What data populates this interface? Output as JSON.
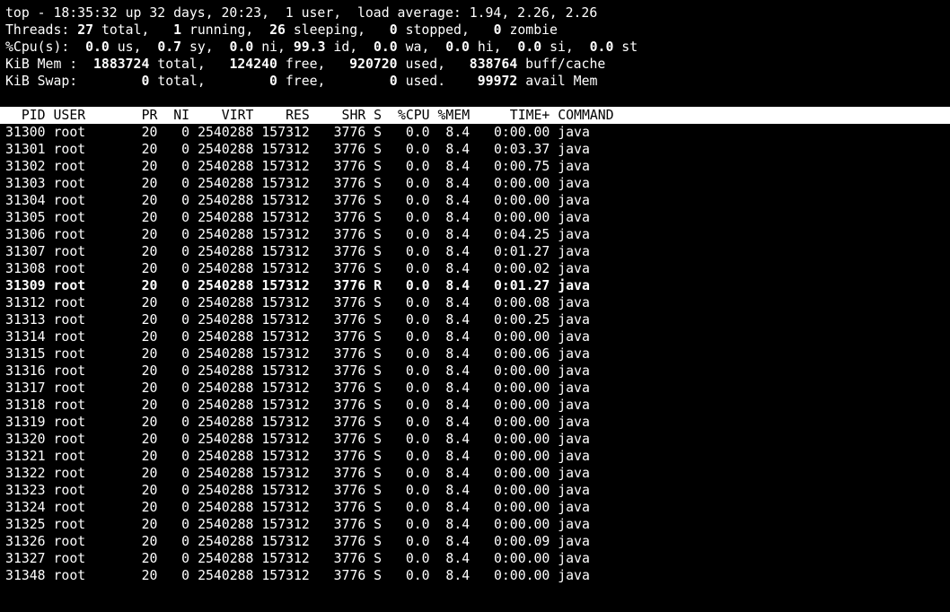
{
  "summary": {
    "line1": {
      "prefix": "top - 18:35:32 up 32 days, 20:23,  1 user,  load average: 1.94, 2.26, 2.26"
    },
    "threads": {
      "label": "Threads:",
      "total": "27",
      "total_label": "total,",
      "running": "1",
      "running_label": "running,",
      "sleeping": "26",
      "sleeping_label": "sleeping,",
      "stopped": "0",
      "stopped_label": "stopped,",
      "zombie": "0",
      "zombie_label": "zombie"
    },
    "cpu": {
      "label": "%Cpu(s):",
      "us": "0.0",
      "us_label": "us,",
      "sy": "0.7",
      "sy_label": "sy,",
      "ni": "0.0",
      "ni_label": "ni,",
      "id": "99.3",
      "id_label": "id,",
      "wa": "0.0",
      "wa_label": "wa,",
      "hi": "0.0",
      "hi_label": "hi,",
      "si": "0.0",
      "si_label": "si,",
      "st": "0.0",
      "st_label": "st"
    },
    "mem": {
      "label": "KiB Mem :",
      "total": "1883724",
      "total_label": "total,",
      "free": "124240",
      "free_label": "free,",
      "used": "920720",
      "used_label": "used,",
      "buff": "838764",
      "buff_label": "buff/cache"
    },
    "swap": {
      "label": "KiB Swap:",
      "total": "0",
      "total_label": "total,",
      "free": "0",
      "free_label": "free,",
      "used": "0",
      "used_label": "used.",
      "avail": "99972",
      "avail_label": "avail Mem"
    }
  },
  "columns": [
    "PID",
    "USER",
    "PR",
    "NI",
    "VIRT",
    "RES",
    "SHR",
    "S",
    "%CPU",
    "%MEM",
    "TIME+",
    "COMMAND"
  ],
  "processes": [
    {
      "pid": "31300",
      "user": "root",
      "pr": "20",
      "ni": "0",
      "virt": "2540288",
      "res": "157312",
      "shr": "3776",
      "s": "S",
      "cpu": "0.0",
      "mem": "8.4",
      "time": "0:00.00",
      "cmd": "java",
      "highlight": false
    },
    {
      "pid": "31301",
      "user": "root",
      "pr": "20",
      "ni": "0",
      "virt": "2540288",
      "res": "157312",
      "shr": "3776",
      "s": "S",
      "cpu": "0.0",
      "mem": "8.4",
      "time": "0:03.37",
      "cmd": "java",
      "highlight": false
    },
    {
      "pid": "31302",
      "user": "root",
      "pr": "20",
      "ni": "0",
      "virt": "2540288",
      "res": "157312",
      "shr": "3776",
      "s": "S",
      "cpu": "0.0",
      "mem": "8.4",
      "time": "0:00.75",
      "cmd": "java",
      "highlight": false
    },
    {
      "pid": "31303",
      "user": "root",
      "pr": "20",
      "ni": "0",
      "virt": "2540288",
      "res": "157312",
      "shr": "3776",
      "s": "S",
      "cpu": "0.0",
      "mem": "8.4",
      "time": "0:00.00",
      "cmd": "java",
      "highlight": false
    },
    {
      "pid": "31304",
      "user": "root",
      "pr": "20",
      "ni": "0",
      "virt": "2540288",
      "res": "157312",
      "shr": "3776",
      "s": "S",
      "cpu": "0.0",
      "mem": "8.4",
      "time": "0:00.00",
      "cmd": "java",
      "highlight": false
    },
    {
      "pid": "31305",
      "user": "root",
      "pr": "20",
      "ni": "0",
      "virt": "2540288",
      "res": "157312",
      "shr": "3776",
      "s": "S",
      "cpu": "0.0",
      "mem": "8.4",
      "time": "0:00.00",
      "cmd": "java",
      "highlight": false
    },
    {
      "pid": "31306",
      "user": "root",
      "pr": "20",
      "ni": "0",
      "virt": "2540288",
      "res": "157312",
      "shr": "3776",
      "s": "S",
      "cpu": "0.0",
      "mem": "8.4",
      "time": "0:04.25",
      "cmd": "java",
      "highlight": false
    },
    {
      "pid": "31307",
      "user": "root",
      "pr": "20",
      "ni": "0",
      "virt": "2540288",
      "res": "157312",
      "shr": "3776",
      "s": "S",
      "cpu": "0.0",
      "mem": "8.4",
      "time": "0:01.27",
      "cmd": "java",
      "highlight": false
    },
    {
      "pid": "31308",
      "user": "root",
      "pr": "20",
      "ni": "0",
      "virt": "2540288",
      "res": "157312",
      "shr": "3776",
      "s": "S",
      "cpu": "0.0",
      "mem": "8.4",
      "time": "0:00.02",
      "cmd": "java",
      "highlight": false
    },
    {
      "pid": "31309",
      "user": "root",
      "pr": "20",
      "ni": "0",
      "virt": "2540288",
      "res": "157312",
      "shr": "3776",
      "s": "R",
      "cpu": "0.0",
      "mem": "8.4",
      "time": "0:01.27",
      "cmd": "java",
      "highlight": true
    },
    {
      "pid": "31312",
      "user": "root",
      "pr": "20",
      "ni": "0",
      "virt": "2540288",
      "res": "157312",
      "shr": "3776",
      "s": "S",
      "cpu": "0.0",
      "mem": "8.4",
      "time": "0:00.08",
      "cmd": "java",
      "highlight": false
    },
    {
      "pid": "31313",
      "user": "root",
      "pr": "20",
      "ni": "0",
      "virt": "2540288",
      "res": "157312",
      "shr": "3776",
      "s": "S",
      "cpu": "0.0",
      "mem": "8.4",
      "time": "0:00.25",
      "cmd": "java",
      "highlight": false
    },
    {
      "pid": "31314",
      "user": "root",
      "pr": "20",
      "ni": "0",
      "virt": "2540288",
      "res": "157312",
      "shr": "3776",
      "s": "S",
      "cpu": "0.0",
      "mem": "8.4",
      "time": "0:00.00",
      "cmd": "java",
      "highlight": false
    },
    {
      "pid": "31315",
      "user": "root",
      "pr": "20",
      "ni": "0",
      "virt": "2540288",
      "res": "157312",
      "shr": "3776",
      "s": "S",
      "cpu": "0.0",
      "mem": "8.4",
      "time": "0:00.06",
      "cmd": "java",
      "highlight": false
    },
    {
      "pid": "31316",
      "user": "root",
      "pr": "20",
      "ni": "0",
      "virt": "2540288",
      "res": "157312",
      "shr": "3776",
      "s": "S",
      "cpu": "0.0",
      "mem": "8.4",
      "time": "0:00.00",
      "cmd": "java",
      "highlight": false
    },
    {
      "pid": "31317",
      "user": "root",
      "pr": "20",
      "ni": "0",
      "virt": "2540288",
      "res": "157312",
      "shr": "3776",
      "s": "S",
      "cpu": "0.0",
      "mem": "8.4",
      "time": "0:00.00",
      "cmd": "java",
      "highlight": false
    },
    {
      "pid": "31318",
      "user": "root",
      "pr": "20",
      "ni": "0",
      "virt": "2540288",
      "res": "157312",
      "shr": "3776",
      "s": "S",
      "cpu": "0.0",
      "mem": "8.4",
      "time": "0:00.00",
      "cmd": "java",
      "highlight": false
    },
    {
      "pid": "31319",
      "user": "root",
      "pr": "20",
      "ni": "0",
      "virt": "2540288",
      "res": "157312",
      "shr": "3776",
      "s": "S",
      "cpu": "0.0",
      "mem": "8.4",
      "time": "0:00.00",
      "cmd": "java",
      "highlight": false
    },
    {
      "pid": "31320",
      "user": "root",
      "pr": "20",
      "ni": "0",
      "virt": "2540288",
      "res": "157312",
      "shr": "3776",
      "s": "S",
      "cpu": "0.0",
      "mem": "8.4",
      "time": "0:00.00",
      "cmd": "java",
      "highlight": false
    },
    {
      "pid": "31321",
      "user": "root",
      "pr": "20",
      "ni": "0",
      "virt": "2540288",
      "res": "157312",
      "shr": "3776",
      "s": "S",
      "cpu": "0.0",
      "mem": "8.4",
      "time": "0:00.00",
      "cmd": "java",
      "highlight": false
    },
    {
      "pid": "31322",
      "user": "root",
      "pr": "20",
      "ni": "0",
      "virt": "2540288",
      "res": "157312",
      "shr": "3776",
      "s": "S",
      "cpu": "0.0",
      "mem": "8.4",
      "time": "0:00.00",
      "cmd": "java",
      "highlight": false
    },
    {
      "pid": "31323",
      "user": "root",
      "pr": "20",
      "ni": "0",
      "virt": "2540288",
      "res": "157312",
      "shr": "3776",
      "s": "S",
      "cpu": "0.0",
      "mem": "8.4",
      "time": "0:00.00",
      "cmd": "java",
      "highlight": false
    },
    {
      "pid": "31324",
      "user": "root",
      "pr": "20",
      "ni": "0",
      "virt": "2540288",
      "res": "157312",
      "shr": "3776",
      "s": "S",
      "cpu": "0.0",
      "mem": "8.4",
      "time": "0:00.00",
      "cmd": "java",
      "highlight": false
    },
    {
      "pid": "31325",
      "user": "root",
      "pr": "20",
      "ni": "0",
      "virt": "2540288",
      "res": "157312",
      "shr": "3776",
      "s": "S",
      "cpu": "0.0",
      "mem": "8.4",
      "time": "0:00.00",
      "cmd": "java",
      "highlight": false
    },
    {
      "pid": "31326",
      "user": "root",
      "pr": "20",
      "ni": "0",
      "virt": "2540288",
      "res": "157312",
      "shr": "3776",
      "s": "S",
      "cpu": "0.0",
      "mem": "8.4",
      "time": "0:00.09",
      "cmd": "java",
      "highlight": false
    },
    {
      "pid": "31327",
      "user": "root",
      "pr": "20",
      "ni": "0",
      "virt": "2540288",
      "res": "157312",
      "shr": "3776",
      "s": "S",
      "cpu": "0.0",
      "mem": "8.4",
      "time": "0:00.00",
      "cmd": "java",
      "highlight": false
    },
    {
      "pid": "31348",
      "user": "root",
      "pr": "20",
      "ni": "0",
      "virt": "2540288",
      "res": "157312",
      "shr": "3776",
      "s": "S",
      "cpu": "0.0",
      "mem": "8.4",
      "time": "0:00.00",
      "cmd": "java",
      "highlight": false
    }
  ],
  "colors": {
    "background": "#000000",
    "foreground": "#ffffff",
    "header_bg": "#ffffff",
    "header_fg": "#000000"
  }
}
